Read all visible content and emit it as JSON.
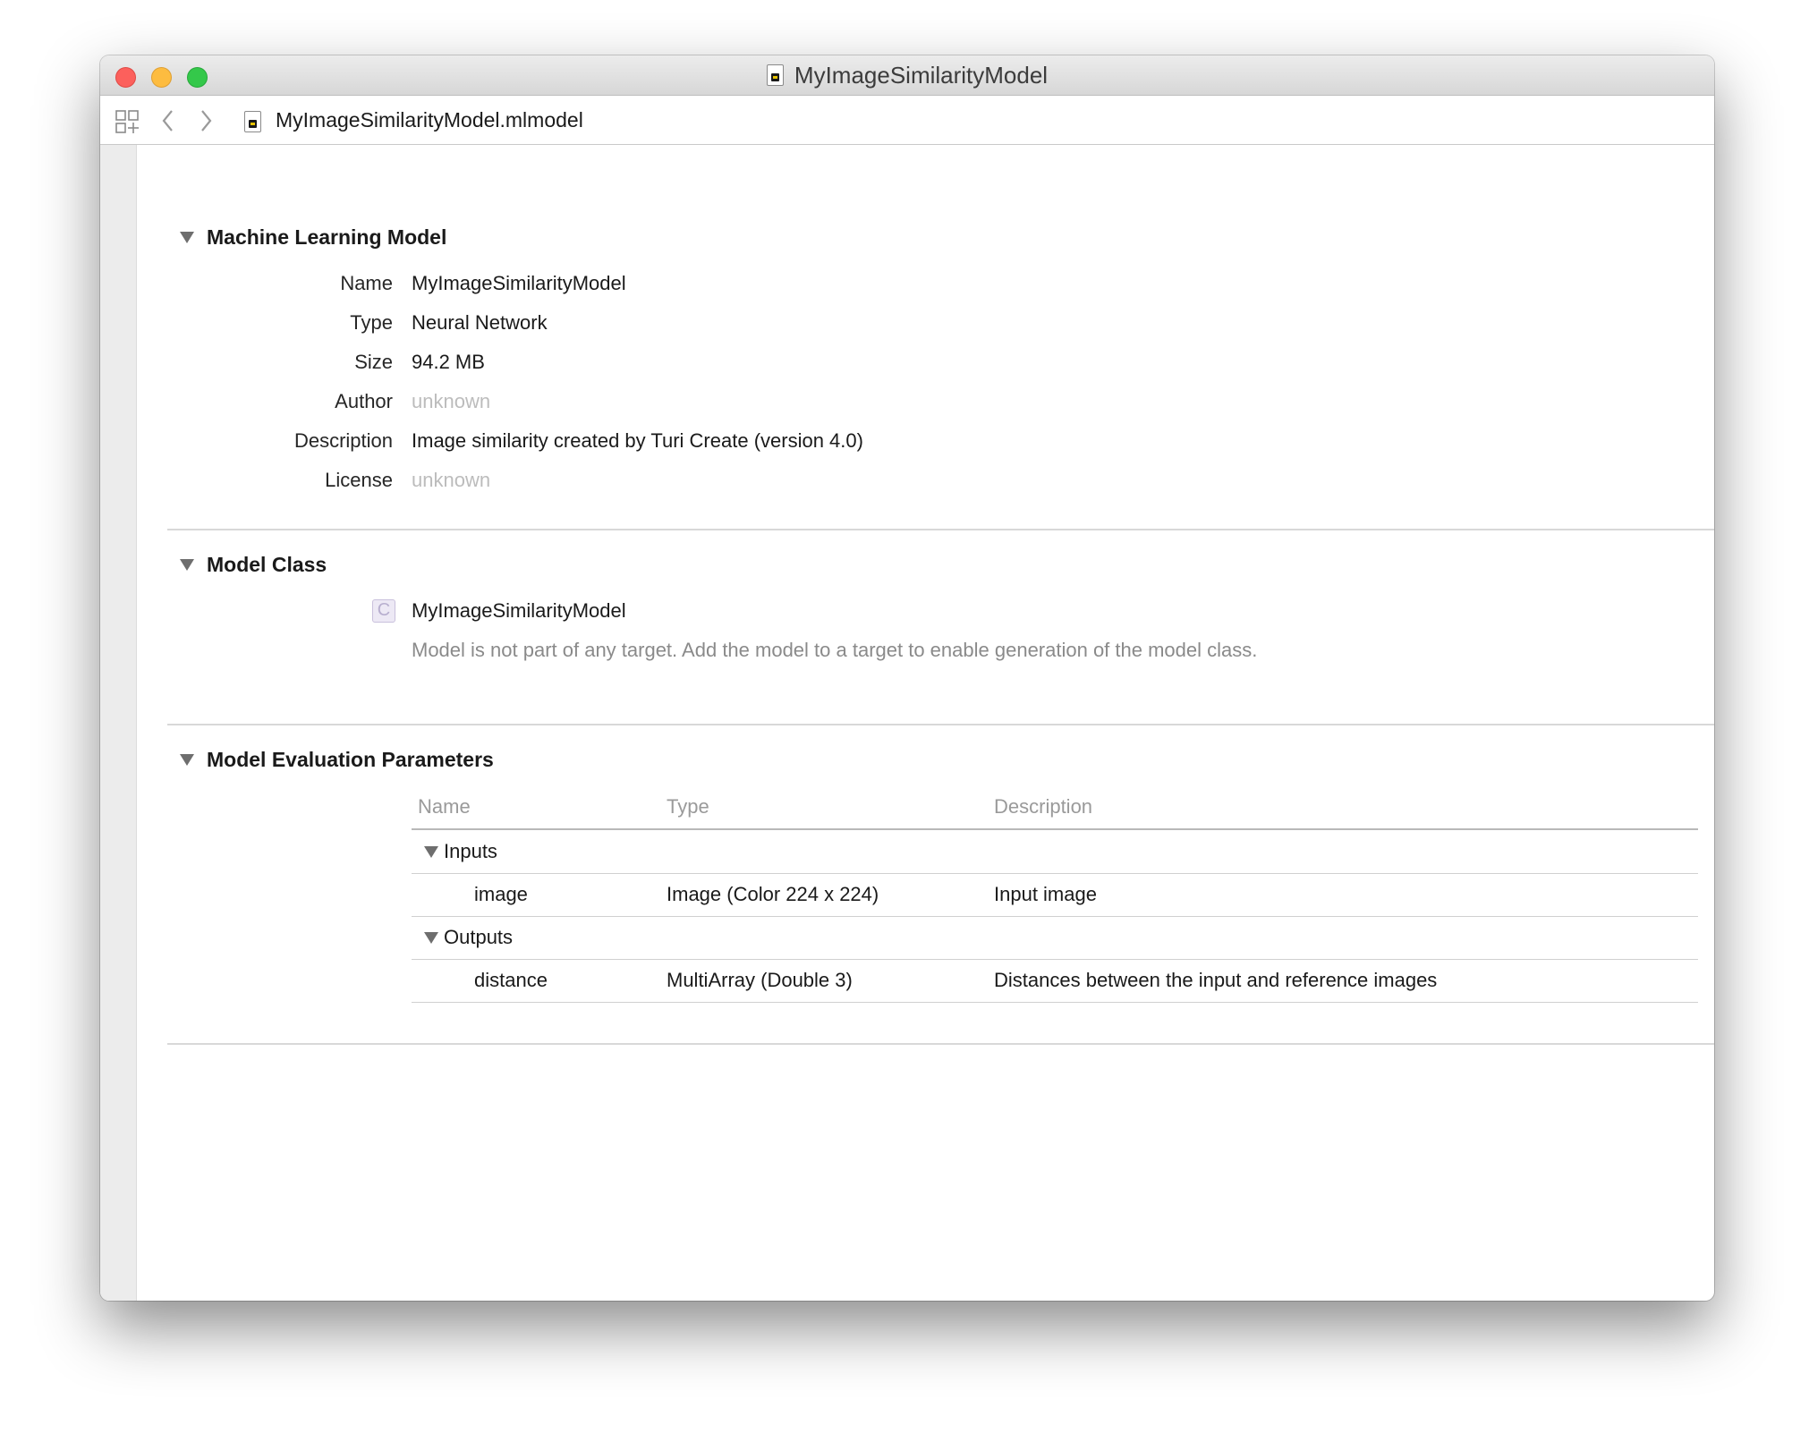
{
  "window": {
    "title": "MyImageSimilarityModel"
  },
  "jumpbar": {
    "file_name": "MyImageSimilarityModel.mlmodel"
  },
  "ml_model": {
    "section_title": "Machine Learning Model",
    "fields": [
      {
        "label": "Name",
        "value": "MyImageSimilarityModel"
      },
      {
        "label": "Type",
        "value": "Neural Network"
      },
      {
        "label": "Size",
        "value": "94.2 MB"
      },
      {
        "label": "Author",
        "value": "unknown"
      },
      {
        "label": "Description",
        "value": "Image similarity created by Turi Create (version 4.0)"
      },
      {
        "label": "License",
        "value": "unknown"
      }
    ]
  },
  "model_class": {
    "section_title": "Model Class",
    "class_icon_letter": "C",
    "class_name": "MyImageSimilarityModel",
    "note": "Model is not part of any target. Add the model to a target to enable generation of the model class."
  },
  "eval_params": {
    "section_title": "Model Evaluation Parameters",
    "columns": [
      "Name",
      "Type",
      "Description"
    ],
    "groups": [
      {
        "label": "Inputs",
        "rows": [
          {
            "name": "image",
            "type": "Image (Color 224 x 224)",
            "description": "Input image"
          }
        ]
      },
      {
        "label": "Outputs",
        "rows": [
          {
            "name": "distance",
            "type": "MultiArray (Double 3)",
            "description": "Distances between the input and reference images"
          }
        ]
      }
    ]
  },
  "colors": {
    "close": "#fc605c",
    "minimize": "#fdbc40",
    "maximize": "#34c84a",
    "muted_text": "#bcbcbc"
  },
  "icons": {
    "grid": "grid-icon",
    "back": "chevron-left-icon",
    "forward": "chevron-right-icon",
    "file": "mlmodel-file-icon",
    "class": "class-icon"
  }
}
